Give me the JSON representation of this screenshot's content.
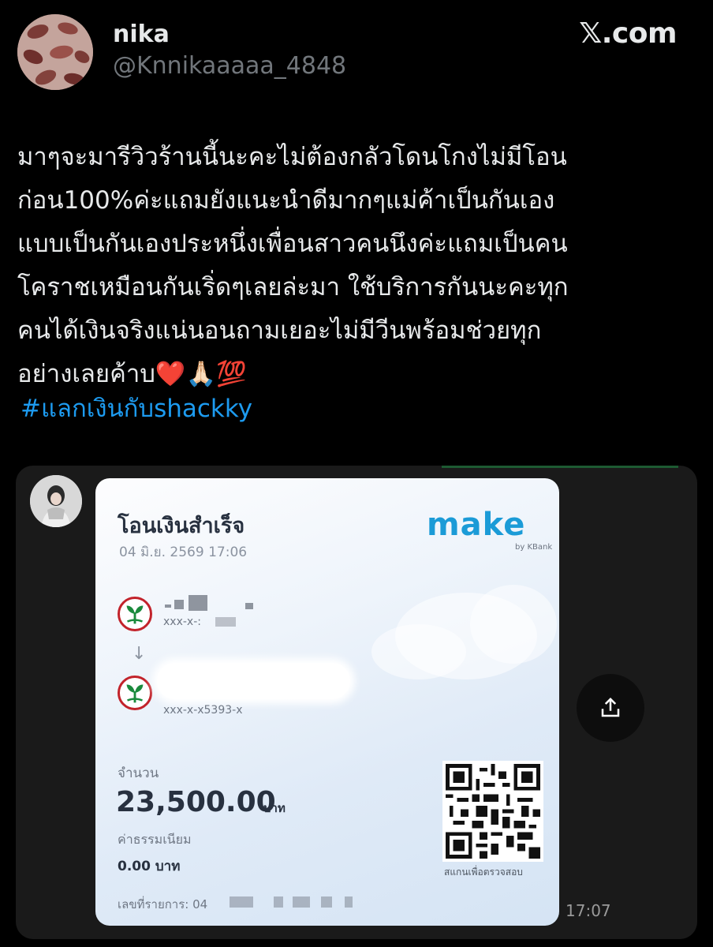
{
  "header": {
    "display_name": "nika",
    "handle": "@Knnikaaaaa_4848",
    "brand": "𝕏.com"
  },
  "tweet": {
    "lines": [
      "มาๆจะมารีวิวร้านนี้นะคะไม่ต้องกลัวโดนโกงไม่มีโอน",
      "ก่อน100%ค่ะแถมยังแนะนำดีมากๆแม่ค้าเป็นกันเอง",
      "แบบเป็นกันเองประหนึ่งเพื่อนสาวคนนึงค่ะแถมเป็นคน",
      "โคราชเหมือนกันเริ่ดๆเลยล่ะมา ใช้บริการกันนะคะทุก",
      "คนได้เงินจริงแน่นอนถามเยอะไม่มีวีนพร้อมช่วยทุก",
      "อย่างเลยค้าบ❤️🙏🏻💯"
    ],
    "hashtag": "#แลกเงินกับshackky"
  },
  "slip": {
    "title": "โอนเงินสำเร็จ",
    "date": "04 มิ.ย. 2569 17:06",
    "logo": "make",
    "logo_sub": "by KBank",
    "sender_account": "xxx-x-:",
    "receiver_account": "xxx-x-x5393-x",
    "amount_label": "จำนวน",
    "amount": "23,500.00",
    "amount_unit": "บาท",
    "fee_label": "ค่าธรรมเนียม",
    "fee": "0.00 บาท",
    "ref_label": "เลขที่รายการ: 04",
    "qr_label": "สแกนเพื่อตรวจสอบ"
  },
  "chat": {
    "time": "17:07"
  },
  "colors": {
    "background": "#000000",
    "hashtag": "#1d9bf0",
    "muted": "#71767b",
    "kbank_red": "#c2232b",
    "kbank_green": "#1a8a3c"
  },
  "icons": [
    "kbank-logo-icon",
    "down-arrow-icon",
    "share-icon",
    "qr-code"
  ]
}
